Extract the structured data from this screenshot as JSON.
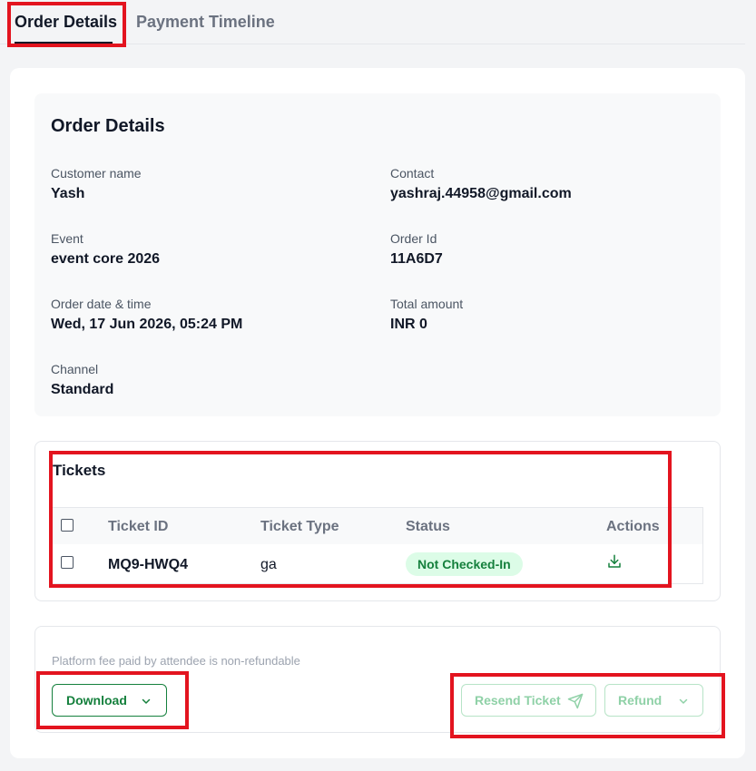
{
  "tabs": [
    {
      "label": "Order Details",
      "active": true
    },
    {
      "label": "Payment Timeline",
      "active": false
    }
  ],
  "order_details": {
    "title": "Order Details",
    "fields": {
      "customer_name": {
        "label": "Customer name",
        "value": "Yash"
      },
      "contact": {
        "label": "Contact",
        "value": "yashraj.44958@gmail.com"
      },
      "event": {
        "label": "Event",
        "value": "event core 2026"
      },
      "order_id": {
        "label": "Order Id",
        "value": "11A6D7"
      },
      "order_date": {
        "label": "Order date & time",
        "value": "Wed, 17 Jun 2026, 05:24 PM"
      },
      "total_amount": {
        "label": "Total amount",
        "value": "INR 0"
      },
      "channel": {
        "label": "Channel",
        "value": "Standard"
      }
    }
  },
  "tickets": {
    "title": "Tickets",
    "columns": [
      "Ticket ID",
      "Ticket Type",
      "Status",
      "Actions"
    ],
    "rows": [
      {
        "ticket_id": "MQ9-HWQ4",
        "ticket_type": "ga",
        "status": "Not Checked-In",
        "action_icon": "download-icon"
      }
    ]
  },
  "footer": {
    "fee_note": "Platform fee paid by attendee is non-refundable",
    "download_label": "Download",
    "resend_label": "Resend Ticket",
    "refund_label": "Refund"
  },
  "colors": {
    "accent_green": "#15803d",
    "status_bg": "#dcfce7",
    "highlight_red": "#e3141f"
  }
}
